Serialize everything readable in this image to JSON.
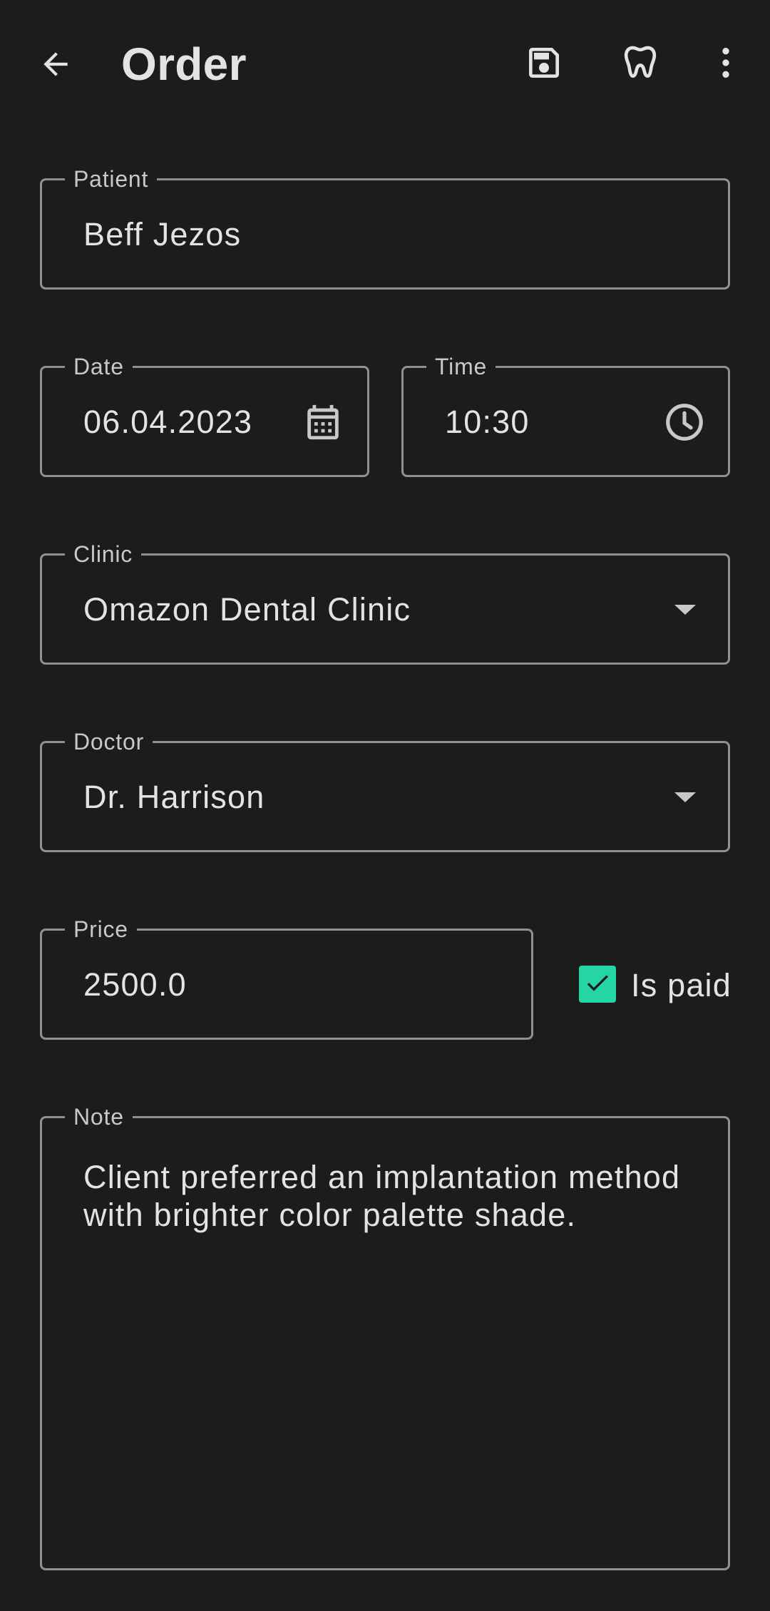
{
  "appbar": {
    "title": "Order",
    "icons": [
      "back-arrow-icon",
      "save-icon",
      "tooth-icon",
      "more-vertical-icon"
    ]
  },
  "form": {
    "patient": {
      "label": "Patient",
      "value": "Beff Jezos"
    },
    "date": {
      "label": "Date",
      "value": "06.04.2023",
      "icon": "calendar-icon"
    },
    "time": {
      "label": "Time",
      "value": "10:30",
      "icon": "clock-icon"
    },
    "clinic": {
      "label": "Clinic",
      "value": "Omazon Dental Clinic",
      "icon": "dropdown-arrow-icon"
    },
    "doctor": {
      "label": "Doctor",
      "value": "Dr. Harrison",
      "icon": "dropdown-arrow-icon"
    },
    "price": {
      "label": "Price",
      "value": "2500.0"
    },
    "is_paid": {
      "label": "Is paid",
      "checked": true
    },
    "note": {
      "label": "Note",
      "value": "Client preferred an implantation method with brighter color palette shade."
    }
  },
  "colors": {
    "background": "#1b1c1c",
    "text": "#e4e3e1",
    "outline": "#8e9190",
    "accent": "#25d6a5"
  }
}
